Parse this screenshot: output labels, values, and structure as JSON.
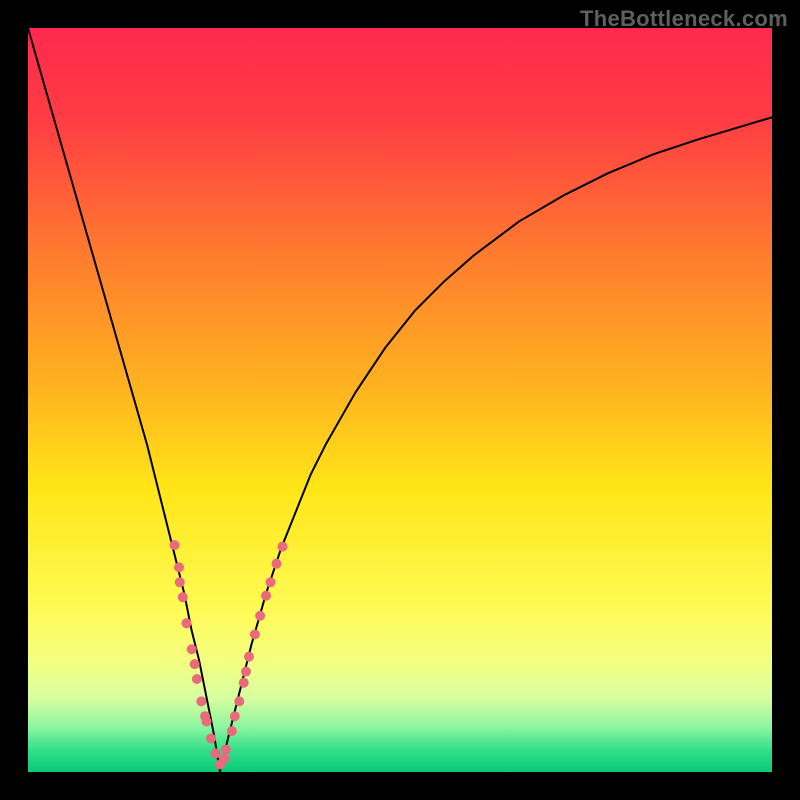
{
  "watermark": "TheBottleneck.com",
  "chart_data": {
    "type": "line",
    "title": "",
    "xlabel": "",
    "ylabel": "",
    "xlim": [
      0,
      100
    ],
    "ylim": [
      0,
      100
    ],
    "grid": false,
    "legend": null,
    "background_gradient": {
      "stops": [
        {
          "pos": 0.0,
          "color": "#ff2a4d"
        },
        {
          "pos": 0.12,
          "color": "#ff3b44"
        },
        {
          "pos": 0.3,
          "color": "#ff7a2f"
        },
        {
          "pos": 0.48,
          "color": "#ffb21f"
        },
        {
          "pos": 0.62,
          "color": "#ffe617"
        },
        {
          "pos": 0.78,
          "color": "#fffb55"
        },
        {
          "pos": 0.85,
          "color": "#f4ff80"
        },
        {
          "pos": 0.9,
          "color": "#d9ffa0"
        },
        {
          "pos": 0.94,
          "color": "#8bf5a0"
        },
        {
          "pos": 0.97,
          "color": "#35e08a"
        },
        {
          "pos": 1.0,
          "color": "#08c977"
        }
      ]
    },
    "series": [
      {
        "name": "curve-left",
        "color": "#000000",
        "stroke_width": 2,
        "x": [
          0,
          2,
          4,
          6,
          8,
          10,
          12,
          14,
          16,
          18,
          19,
          20,
          21,
          22,
          23,
          24,
          25,
          25.8
        ],
        "values": [
          100,
          93,
          86,
          79,
          72,
          65,
          58,
          51,
          44,
          36,
          32,
          28,
          24,
          19,
          15,
          10,
          5,
          0
        ]
      },
      {
        "name": "curve-right",
        "color": "#000000",
        "stroke_width": 2,
        "x": [
          25.8,
          27,
          28,
          29,
          30,
          32,
          34,
          36,
          38,
          40,
          44,
          48,
          52,
          56,
          60,
          66,
          72,
          78,
          84,
          90,
          96,
          100
        ],
        "values": [
          0,
          5,
          9,
          13,
          17,
          24,
          30,
          35,
          40,
          44,
          51,
          57,
          62,
          66,
          69.5,
          74,
          77.5,
          80.5,
          83,
          85,
          86.8,
          88
        ]
      }
    ],
    "scatter_overlay": {
      "name": "benchmark-points",
      "color": "#e96b7b",
      "radius": 5,
      "points": [
        {
          "x": 19.7,
          "y": 30.5
        },
        {
          "x": 20.3,
          "y": 27.5
        },
        {
          "x": 20.4,
          "y": 25.5
        },
        {
          "x": 20.8,
          "y": 23.5
        },
        {
          "x": 21.3,
          "y": 20.0
        },
        {
          "x": 22.0,
          "y": 16.5
        },
        {
          "x": 22.4,
          "y": 14.5
        },
        {
          "x": 22.7,
          "y": 12.5
        },
        {
          "x": 23.3,
          "y": 9.5
        },
        {
          "x": 23.8,
          "y": 7.5
        },
        {
          "x": 24.0,
          "y": 6.8
        },
        {
          "x": 24.6,
          "y": 4.5
        },
        {
          "x": 25.2,
          "y": 2.5
        },
        {
          "x": 25.8,
          "y": 1.0
        },
        {
          "x": 26.4,
          "y": 1.8
        },
        {
          "x": 26.6,
          "y": 3.0
        },
        {
          "x": 27.4,
          "y": 5.5
        },
        {
          "x": 27.8,
          "y": 7.5
        },
        {
          "x": 28.4,
          "y": 9.5
        },
        {
          "x": 29.0,
          "y": 12.0
        },
        {
          "x": 29.3,
          "y": 13.5
        },
        {
          "x": 29.7,
          "y": 15.5
        },
        {
          "x": 30.5,
          "y": 18.5
        },
        {
          "x": 31.2,
          "y": 21.0
        },
        {
          "x": 32.0,
          "y": 23.7
        },
        {
          "x": 32.6,
          "y": 25.5
        },
        {
          "x": 33.4,
          "y": 28.0
        },
        {
          "x": 34.2,
          "y": 30.3
        }
      ]
    }
  }
}
